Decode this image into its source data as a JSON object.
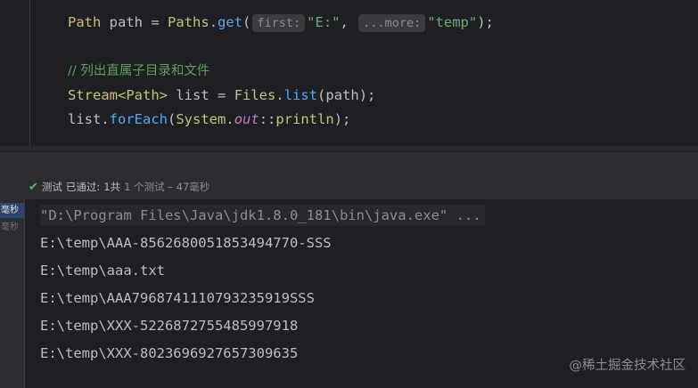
{
  "editor": {
    "line1": {
      "type": "Path",
      "var": "path",
      "eq": "=",
      "cls": "Paths",
      "dot": ".",
      "method": "get",
      "open": "(",
      "hint1": "first:",
      "arg1": "\"E:\"",
      "comma": ",",
      "hint2": "...more:",
      "arg2": "\"temp\"",
      "close": ");"
    },
    "comment": "// 列出直属子目录和文件",
    "line3": {
      "type": "Stream<Path>",
      "var": "list",
      "eq": "=",
      "cls": "Files",
      "dot": ".",
      "method": "list",
      "args": "(path);"
    },
    "line4": {
      "var": "list",
      "dot": ".",
      "method": "forEach",
      "open": "(",
      "cls": "System",
      "dot2": ".",
      "field": "out",
      "sep": "::",
      "ref": "println",
      "close": ");"
    }
  },
  "status": {
    "label": "测试",
    "passed": "已通过:",
    "count": "1共",
    "summary": "1 个测试 – 47毫秒"
  },
  "left_panel": {
    "item1": "毫秒",
    "item2": "毫秒"
  },
  "console": {
    "lines": [
      "\"D:\\Program Files\\Java\\jdk1.8.0_181\\bin\\java.exe\" ...",
      "E:\\temp\\AAA-8562680051853494770-SSS",
      "E:\\temp\\aaa.txt",
      "E:\\temp\\AAA7968741110793235919SSS",
      "E:\\temp\\XXX-5226872755485997918",
      "E:\\temp\\XXX-8023696927657309635"
    ]
  },
  "watermark": "@稀土掘金技术社区",
  "colors": {
    "editor_bg": "#1e1f22",
    "panel_bg": "#2b2d30",
    "pass_green": "#5fb865",
    "selection": "#2e436e"
  }
}
